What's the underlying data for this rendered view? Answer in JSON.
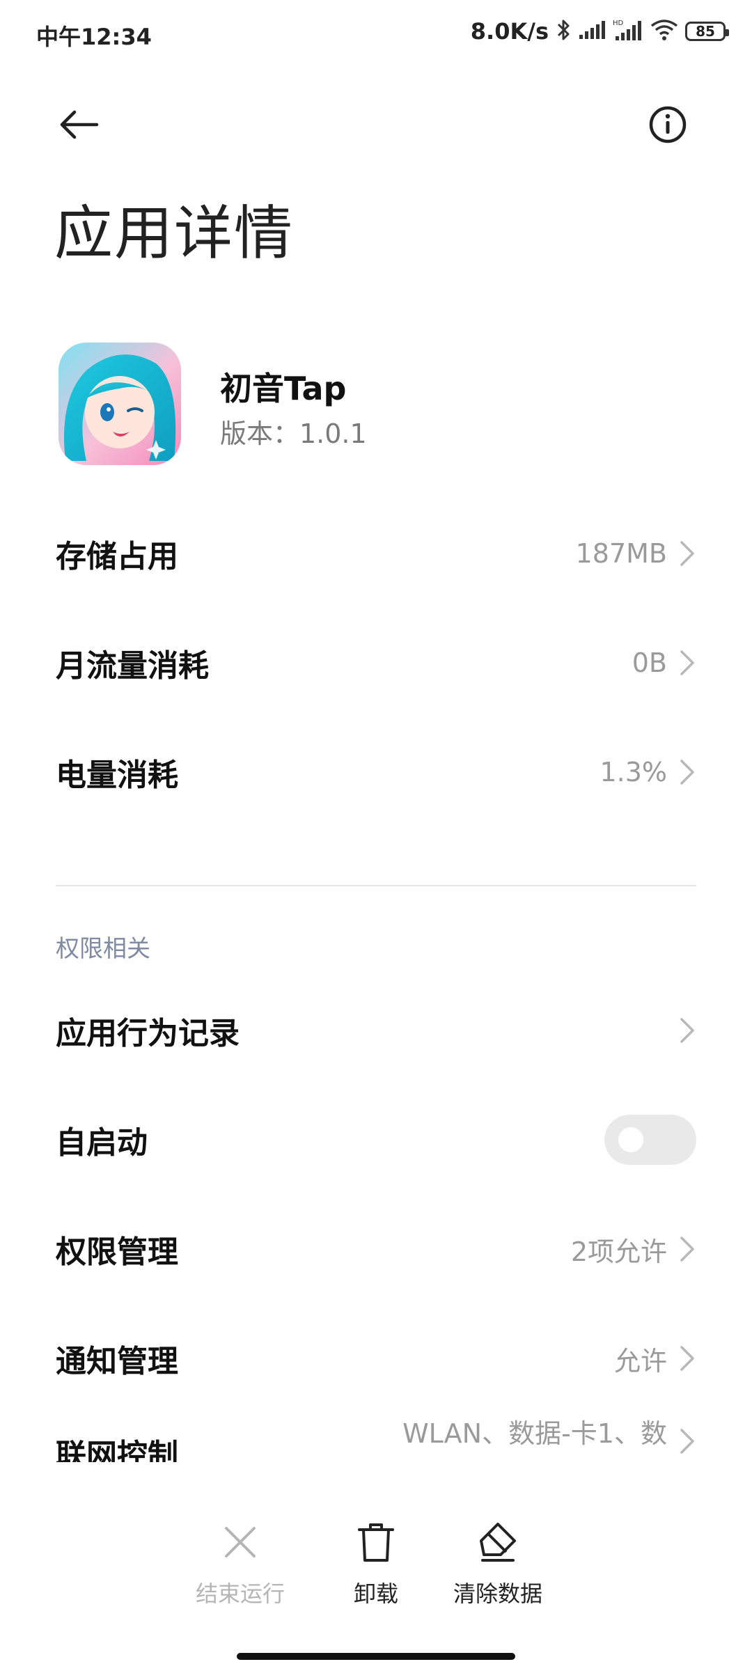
{
  "status_bar": {
    "time": "中午12:34",
    "net_speed": "8.0K/s",
    "battery": "85",
    "icons": [
      "bluetooth-icon",
      "signal-icon",
      "hd-signal-icon",
      "wifi-icon",
      "battery-icon"
    ]
  },
  "header": {
    "title": "应用详情",
    "back_icon": "back-arrow-icon",
    "info_icon": "info-icon"
  },
  "app": {
    "name": "初音Tap",
    "version": "版本：1.0.1"
  },
  "usage_rows": [
    {
      "label": "存储占用",
      "value": "187MB"
    },
    {
      "label": "月流量消耗",
      "value": "0B"
    },
    {
      "label": "电量消耗",
      "value": "1.3%"
    }
  ],
  "permissions": {
    "section_title": "权限相关",
    "rows": [
      {
        "label": "应用行为记录",
        "value": ""
      },
      {
        "label": "自启动",
        "value": "",
        "toggle": false
      },
      {
        "label": "权限管理",
        "value": "2项允许"
      },
      {
        "label": "通知管理",
        "value": "允许"
      },
      {
        "label": "联网控制",
        "value": "WLAN、数据-卡1、数"
      }
    ]
  },
  "bottom_actions": [
    {
      "label": "结束运行",
      "icon": "close-icon",
      "enabled": false
    },
    {
      "label": "卸载",
      "icon": "trash-icon",
      "enabled": true
    },
    {
      "label": "清除数据",
      "icon": "eraser-icon",
      "enabled": true
    }
  ],
  "colors": {
    "accent_section": "#7f8aa3",
    "secondary_text": "#9a9a9a",
    "disabled_text": "#b5b5b5"
  }
}
